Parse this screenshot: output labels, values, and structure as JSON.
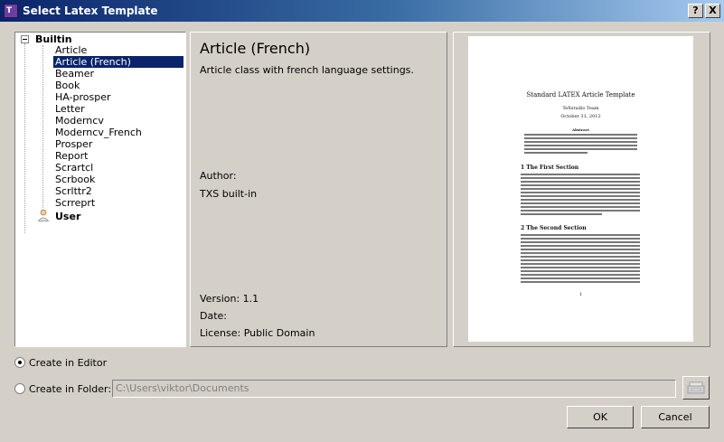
{
  "window": {
    "title": "Select Latex Template",
    "help_button": "?",
    "close_button": "X"
  },
  "tree": {
    "group_builtin": "Builtin",
    "items": [
      "Article",
      "Article (French)",
      "Beamer",
      "Book",
      "HA-prosper",
      "Letter",
      "Moderncv",
      "Moderncv_French",
      "Prosper",
      "Report",
      "Scrartcl",
      "Scrbook",
      "Scrlttr2",
      "Scrreprt"
    ],
    "selected": "Article (French)",
    "group_user": "User"
  },
  "info": {
    "name": "Article (French)",
    "description": "Article class with french language settings.",
    "author_label": "Author:",
    "author_value": "TXS built-in",
    "version_label": "Version:",
    "version_value": "1.1",
    "date_label": "Date:",
    "date_value": "",
    "license_label": "License:",
    "license_value": "Public Domain"
  },
  "preview": {
    "doc_title": "Standard LATEX Article Template",
    "doc_author": "TeXstudio Team",
    "doc_date": "October 31, 2012",
    "abstract_heading": "Abstract",
    "section1": "1   The First Section",
    "section2": "2   The Second Section",
    "page_number": "1"
  },
  "options": {
    "create_in_editor": "Create in Editor",
    "create_in_folder": "Create in Folder:",
    "folder_path": "C:\\Users\\viktor\\Documents",
    "selected": "editor"
  },
  "buttons": {
    "ok": "OK",
    "cancel": "Cancel"
  },
  "colors": {
    "selection": "#0a246a",
    "face": "#d4d0c8",
    "titlebar_start": "#0a246a",
    "titlebar_end": "#a6caf0"
  },
  "icons": {
    "app": "latex-icon",
    "user": "user-icon",
    "browse": "folder-browse-icon"
  }
}
